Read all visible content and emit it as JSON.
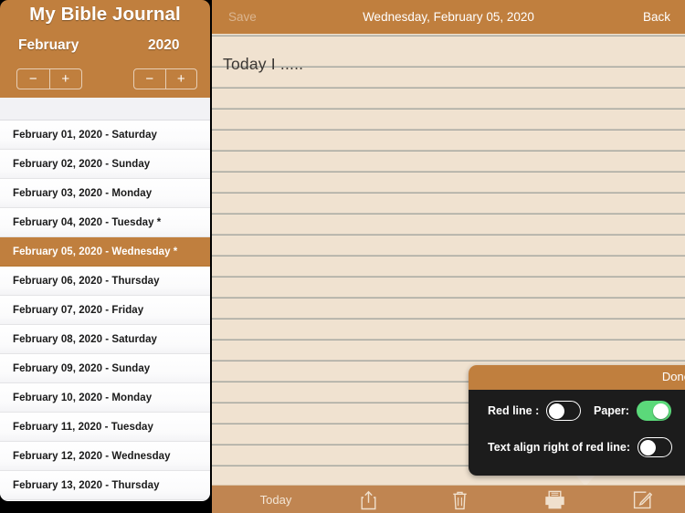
{
  "sidebar": {
    "app_title": "My Bible Journal",
    "month_label": "February",
    "year_label": "2020",
    "month_stepper": {
      "minus": "−",
      "plus": "+"
    },
    "year_stepper": {
      "minus": "−",
      "plus": "+"
    },
    "rows": [
      {
        "text": "February 01, 2020  -  Saturday",
        "selected": false
      },
      {
        "text": "February 02, 2020  -  Sunday",
        "selected": false
      },
      {
        "text": "February 03, 2020  -  Monday",
        "selected": false
      },
      {
        "text": "February 04, 2020  -  Tuesday *",
        "selected": false
      },
      {
        "text": "February 05, 2020  -  Wednesday *",
        "selected": true
      },
      {
        "text": "February 06, 2020  -  Thursday",
        "selected": false
      },
      {
        "text": "February 07, 2020  -  Friday",
        "selected": false
      },
      {
        "text": "February 08, 2020  -  Saturday",
        "selected": false
      },
      {
        "text": "February 09, 2020  -  Sunday",
        "selected": false
      },
      {
        "text": "February 10, 2020  -  Monday",
        "selected": false
      },
      {
        "text": "February 11, 2020  -  Tuesday",
        "selected": false
      },
      {
        "text": "February 12, 2020  -  Wednesday",
        "selected": false
      },
      {
        "text": "February 13, 2020  -  Thursday",
        "selected": false
      }
    ]
  },
  "detail": {
    "save_label": "Save",
    "save_enabled": false,
    "title": "Wednesday, February 05, 2020",
    "back_label": "Back",
    "note_text": "Today I ....."
  },
  "popover": {
    "done_label": "Done",
    "options": [
      {
        "label": "Red line :",
        "state": "off"
      },
      {
        "label": "Paper:",
        "state": "on"
      },
      {
        "label": "Text align right of red line:",
        "state": "off"
      }
    ]
  },
  "toolbar": {
    "today_label": "Today",
    "icons": [
      "share-icon",
      "trash-icon",
      "print-icon",
      "compose-icon"
    ]
  },
  "colors": {
    "brand_brown": "#c07f3e",
    "toolbar_brown": "#c08551",
    "paper": "#f0e2d0",
    "rule_line": "#a8a9a2",
    "popover_dark": "#1c1c1c",
    "switch_on_green": "#5bd97a",
    "selected_row": "#c07f3e"
  }
}
